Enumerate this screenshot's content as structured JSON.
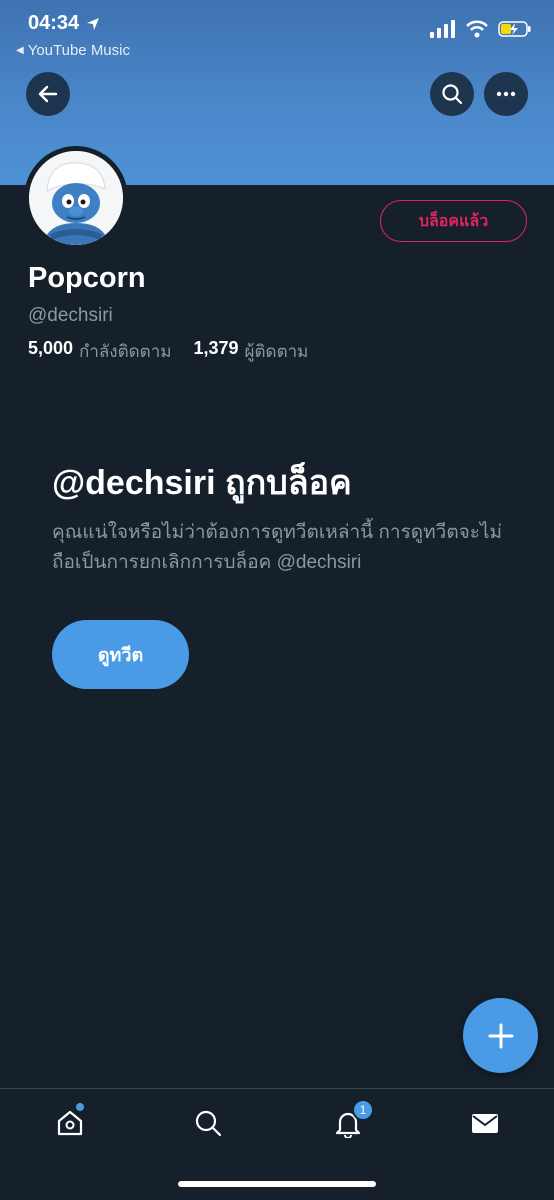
{
  "status_bar": {
    "time": "04:34",
    "back_app_label": "YouTube Music"
  },
  "header": {
    "back_icon": "arrow-left-icon",
    "search_icon": "search-icon",
    "more_icon": "more-horizontal-icon"
  },
  "profile": {
    "name": "Popcorn",
    "handle": "@dechsiri",
    "blocked_button_label": "บล็อคแล้ว",
    "following_count": "5,000",
    "following_label": "กำลังติดตาม",
    "followers_count": "1,379",
    "followers_label": "ผู้ติดตาม"
  },
  "blocked_notice": {
    "title": "@dechsiri ถูกบล็อค",
    "description": "คุณแน่ใจหรือไม่ว่าต้องการดูทวีตเหล่านี้ การดูทวีตจะไม่ถือเป็นการยกเลิกการบล็อค @dechsiri",
    "view_button_label": "ดูทวีต"
  },
  "tab_bar": {
    "items": [
      {
        "icon": "home-icon",
        "has_dot": true
      },
      {
        "icon": "search-icon"
      },
      {
        "icon": "bell-icon",
        "badge": "1"
      },
      {
        "icon": "mail-icon"
      }
    ]
  },
  "colors": {
    "background": "#15202b",
    "accent": "#4a9be6",
    "blocked_red": "#e0245e",
    "muted_text": "#8899a6"
  }
}
